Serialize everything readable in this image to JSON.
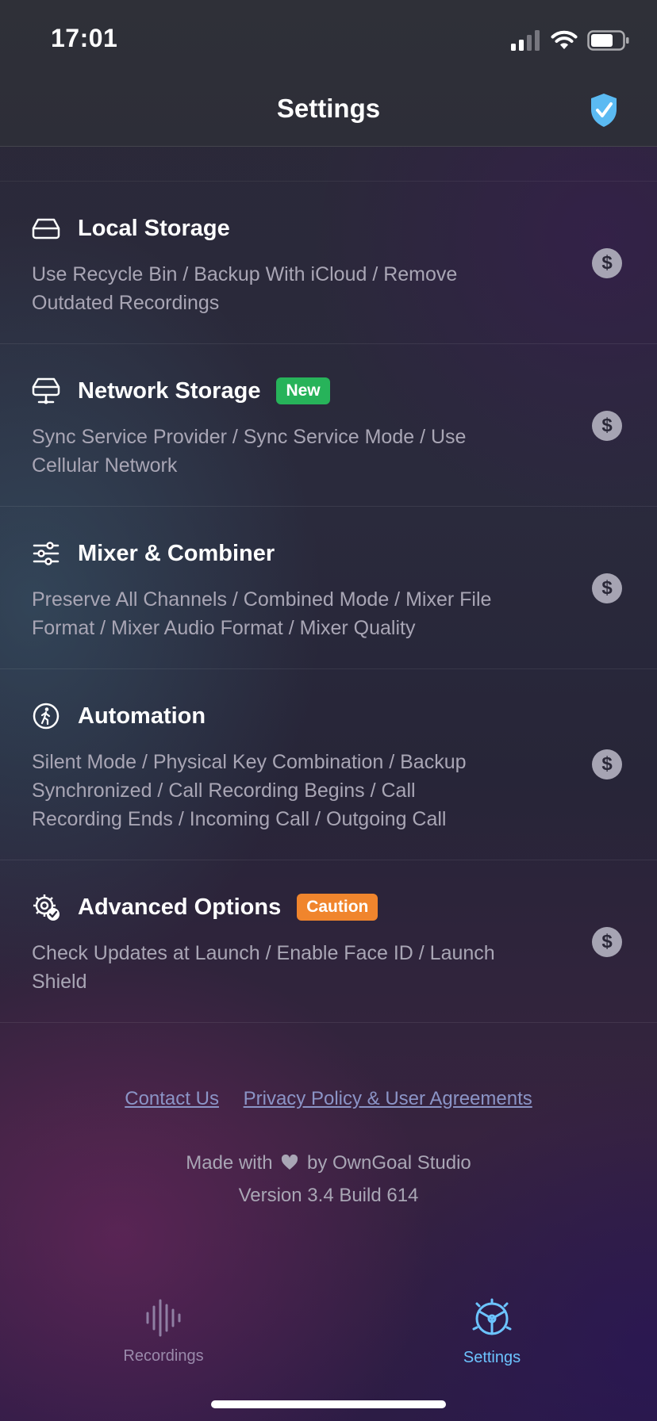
{
  "status_bar": {
    "time": "17:01"
  },
  "nav": {
    "title": "Settings"
  },
  "sections": [
    {
      "title": "Local Storage",
      "badge": "",
      "icon": "drive-icon",
      "description": "Use Recycle Bin / Backup With iCloud / Remove Outdated Recordings"
    },
    {
      "title": "Network Storage",
      "badge": "New",
      "icon": "network-drive-icon",
      "description": "Sync Service Provider / Sync Service Mode / Use Cellular Network"
    },
    {
      "title": "Mixer & Combiner",
      "badge": "",
      "icon": "sliders-icon",
      "description": "Preserve All Channels / Combined Mode / Mixer File Format / Mixer Audio Format / Mixer Quality"
    },
    {
      "title": "Automation",
      "badge": "",
      "icon": "walking-person-icon",
      "description": "Silent Mode / Physical Key Combination / Backup Synchronized / Call Recording Begins / Call Recording Ends / Incoming Call / Outgoing Call"
    },
    {
      "title": "Advanced Options",
      "badge": "Caution",
      "icon": "gear-check-icon",
      "description": "Check Updates at Launch / Enable Face ID / Launch Shield"
    }
  ],
  "pro_marker": "$",
  "links": {
    "contact": "Contact Us",
    "privacy": "Privacy Policy & User Agreements"
  },
  "footer": {
    "made_with_prefix": "Made with",
    "made_with_suffix": "by OwnGoal Studio",
    "version": "Version 3.4 Build 614"
  },
  "tabs": [
    {
      "label": "Recordings",
      "icon": "waveform-icon",
      "active": false
    },
    {
      "label": "Settings",
      "icon": "settings-wheel-icon",
      "active": true
    }
  ],
  "colors": {
    "accent": "#6cc4ff",
    "new_badge": "#27b35a",
    "caution_badge": "#f0852d",
    "link": "#8b94c6"
  }
}
